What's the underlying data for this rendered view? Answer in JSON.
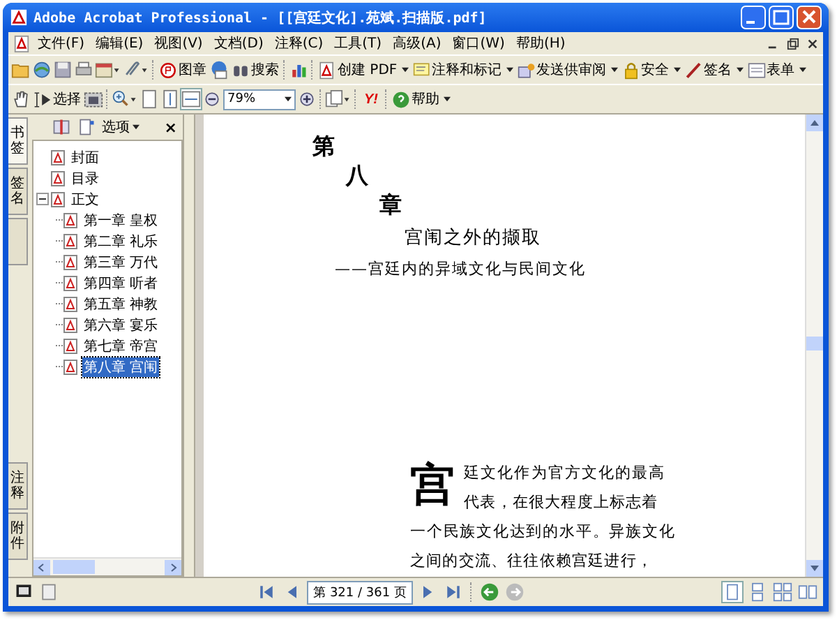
{
  "window": {
    "title": "Adobe Acrobat Professional - [[宫廷文化].苑斌.扫描版.pdf]"
  },
  "menu": [
    "文件(F)",
    "编辑(E)",
    "视图(V)",
    "文档(D)",
    "注释(C)",
    "工具(T)",
    "高级(A)",
    "窗口(W)",
    "帮助(H)"
  ],
  "toolbar": {
    "stamp": "图章",
    "search": "搜索",
    "create_pdf": "创建 PDF",
    "comment": "注释和标记",
    "review": "发送供审阅",
    "security": "安全",
    "sign": "签名",
    "forms": "表单",
    "select": "选择",
    "zoom": "79%",
    "yahoo": "Y!",
    "help": "帮助"
  },
  "side_tabs": [
    {
      "label": "书签",
      "selected": true
    },
    {
      "label": "签名",
      "selected": false
    }
  ],
  "side_tabs_bottom": [
    "注释",
    "附件"
  ],
  "bookmarks": {
    "options": "选项",
    "close": "×",
    "items": [
      {
        "label": "封面",
        "selected": false
      },
      {
        "label": "目录",
        "selected": false
      },
      {
        "label": "正文",
        "selected": false,
        "expanded": true,
        "children": [
          {
            "label": "第一章 皇权",
            "selected": false
          },
          {
            "label": "第二章 礼乐",
            "selected": false
          },
          {
            "label": "第三章 万代",
            "selected": false
          },
          {
            "label": "第四章 听者",
            "selected": false
          },
          {
            "label": "第五章 神教",
            "selected": false
          },
          {
            "label": "第六章 宴乐",
            "selected": false
          },
          {
            "label": "第七章 帝宫",
            "selected": false
          },
          {
            "label": "第八章 宫闱",
            "selected": true
          }
        ]
      }
    ]
  },
  "page": {
    "chapter_chars": [
      "第",
      "八",
      "章"
    ],
    "title": "宫闱之外的撷取",
    "subtitle": "——宫廷内的异域文化与民间文化",
    "drop_cap": "宫",
    "body_beside_cap": "廷文化作为官方文化的最高代表，在很大程度上标志着",
    "body_rest": "一个民族文化达到的水平。异族文化之间的交流、往往依赖宫廷进行，"
  },
  "status": {
    "page": "第 321 / 361 页"
  }
}
